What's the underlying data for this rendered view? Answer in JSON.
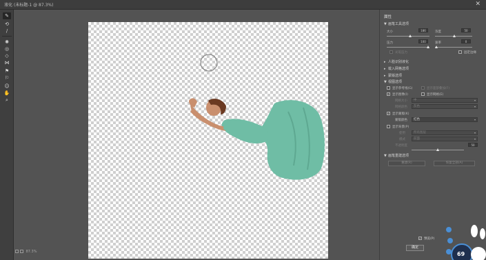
{
  "window": {
    "title": "液化 (未标题-1 @ 87.3%)",
    "close_label": "✕"
  },
  "tools": [
    {
      "name": "forward-warp",
      "glyph": "✎"
    },
    {
      "name": "reconstruct",
      "glyph": "⟲"
    },
    {
      "name": "smooth",
      "glyph": "∕"
    },
    {
      "name": "twirl",
      "glyph": "✺"
    },
    {
      "name": "pucker",
      "glyph": "◎"
    },
    {
      "name": "bloat",
      "glyph": "◇"
    },
    {
      "name": "push-left",
      "glyph": "⋈"
    },
    {
      "name": "freeze-mask",
      "glyph": "⚑"
    },
    {
      "name": "thaw-mask",
      "glyph": "⚐"
    },
    {
      "name": "face",
      "glyph": "☺"
    },
    {
      "name": "hand",
      "glyph": "✋"
    },
    {
      "name": "zoom",
      "glyph": "⌕"
    }
  ],
  "status": {
    "zoom": "87.3%"
  },
  "panel": {
    "title": "属性",
    "brush_section": "画笔工具选项",
    "size_label": "大小",
    "size_value": "186",
    "density_label": "浓度",
    "density_value": "50",
    "pressure_label": "压力",
    "pressure_value": "100",
    "rate_label": "速率",
    "rate_value": "0",
    "stylus_label": "光笔压力",
    "pin_edges_label": "固定边缘",
    "face_section": "人脸识别液化",
    "load_mesh_section": "载入网格选项",
    "mask_section": "蒙版选项",
    "view_section": "视图选项",
    "show_guides": "显示参考线(G)",
    "show_face_overlay": "显示面部叠加(F)",
    "show_image": "显示图像(I)",
    "show_mesh": "显示网格(E)",
    "mesh_size_label": "网格大小",
    "mesh_size_value": "中",
    "mesh_color_label": "网格颜色",
    "mesh_color_value": "灰色",
    "show_mask": "显示蒙版(K)",
    "mask_color_label": "蒙版颜色",
    "mask_color_value": "红色",
    "show_backdrop": "显示背景(P)",
    "use_label": "使用",
    "use_value": "所有图层",
    "mode_label": "模式",
    "mode_value": "前面",
    "opacity_label": "不透明度",
    "opacity_value": "50",
    "reconstruct_section": "画笔重建选项",
    "reconstruct_btn": "重建(R)",
    "restore_all_btn": "恢复全部(A)",
    "preview_label": "预览(P)",
    "ok_label": "确定",
    "overlay_badge": "69"
  },
  "colors": {
    "panel": "#535353",
    "canvas_checker": "#cfcfcf",
    "dress": "#6fbda5",
    "skin": "#c98f6e",
    "hair": "#6b3a22"
  }
}
